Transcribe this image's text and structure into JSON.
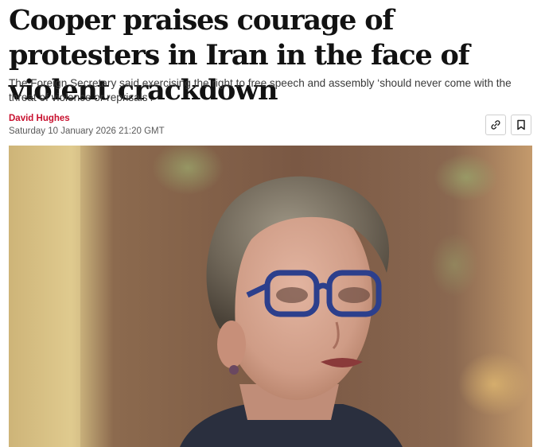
{
  "article": {
    "headline": "Cooper praises courage of protesters in Iran in the face of violent crackdown",
    "standfirst": "The Foreign Secretary said exercising the right to free speech and assembly ‘should never come with the threat of violence or reprisals’.",
    "author": "David Hughes",
    "published": "Saturday 10 January 2026 21:20 GMT"
  },
  "actions": {
    "copy_link_icon": "link-icon",
    "bookmark_icon": "bookmark-icon"
  },
  "colors": {
    "byline": "#c8102e",
    "headline": "#121212",
    "standfirst": "#3a3a3a",
    "dateline": "#5a5a5a"
  }
}
